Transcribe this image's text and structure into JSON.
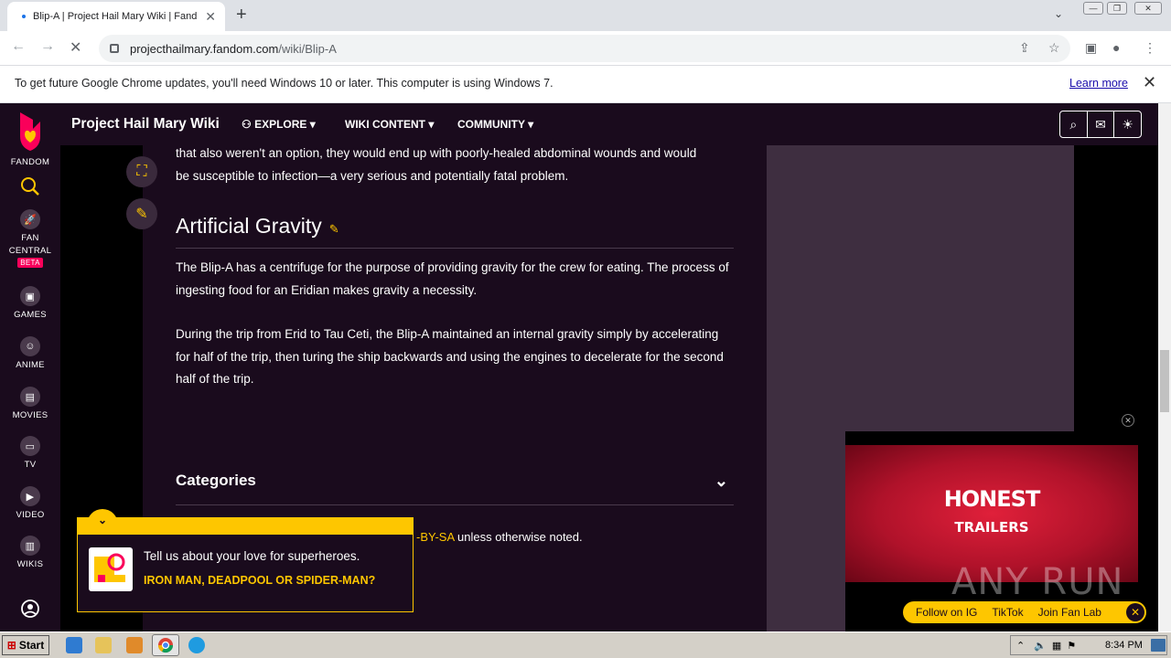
{
  "browser": {
    "tab_title": "Blip-A | Project Hail Mary Wiki | Fand",
    "url_host": "projecthailmary.fandom.com",
    "url_path": "/wiki/Blip-A",
    "infobar_message": "To get future Google Chrome updates, you'll need Windows 10 or later. This computer is using Windows 7.",
    "infobar_link": "Learn more"
  },
  "rail": {
    "fandom": "FANDOM",
    "fan_central_1": "FAN",
    "fan_central_2": "CENTRAL",
    "beta": "BETA",
    "games": "GAMES",
    "anime": "ANIME",
    "movies": "MOVIES",
    "tv": "TV",
    "video": "VIDEO",
    "wikis": "WIKIS"
  },
  "wiki": {
    "name": "Project Hail Mary Wiki",
    "nav": [
      "EXPLORE",
      "WIKI CONTENT",
      "COMMUNITY"
    ]
  },
  "article": {
    "para0_line1": "that also weren't an option, they would end up with poorly-healed abdominal wounds and would",
    "para0_line2": "be susceptible to infection—a very serious and potentially fatal problem.",
    "heading": "Artificial Gravity",
    "para1": "The Blip-A has a centrifuge for the purpose of providing gravity for the crew for eating. The process of ingesting food for an Eridian makes gravity a necessity.",
    "para2": "During the trip from Erid to Tau Ceti, the Blip-A maintained an internal gravity simply by accelerating for half of the trip, then turing the ship backwards and using the engines to decelerate for the second half of the trip.",
    "categories": "Categories",
    "license_link": "-BY-SA",
    "license_rest": " unless otherwise noted."
  },
  "quiz": {
    "line1": "Tell us about your love for superheroes.",
    "line2": "IRON MAN, DEADPOOL OR SPIDER-MAN?"
  },
  "video": {
    "title1": "HONEST",
    "title2": "TRAILERS",
    "social": [
      "Follow on IG",
      "TikTok",
      "Join Fan Lab"
    ]
  },
  "watermark": "ANY RUN",
  "taskbar": {
    "start": "Start",
    "clock": "8:34 PM"
  },
  "colors": {
    "fandom_bg": "#1a0b1d",
    "accent_yellow": "#fec600",
    "fandom_pink": "#fa005a"
  }
}
